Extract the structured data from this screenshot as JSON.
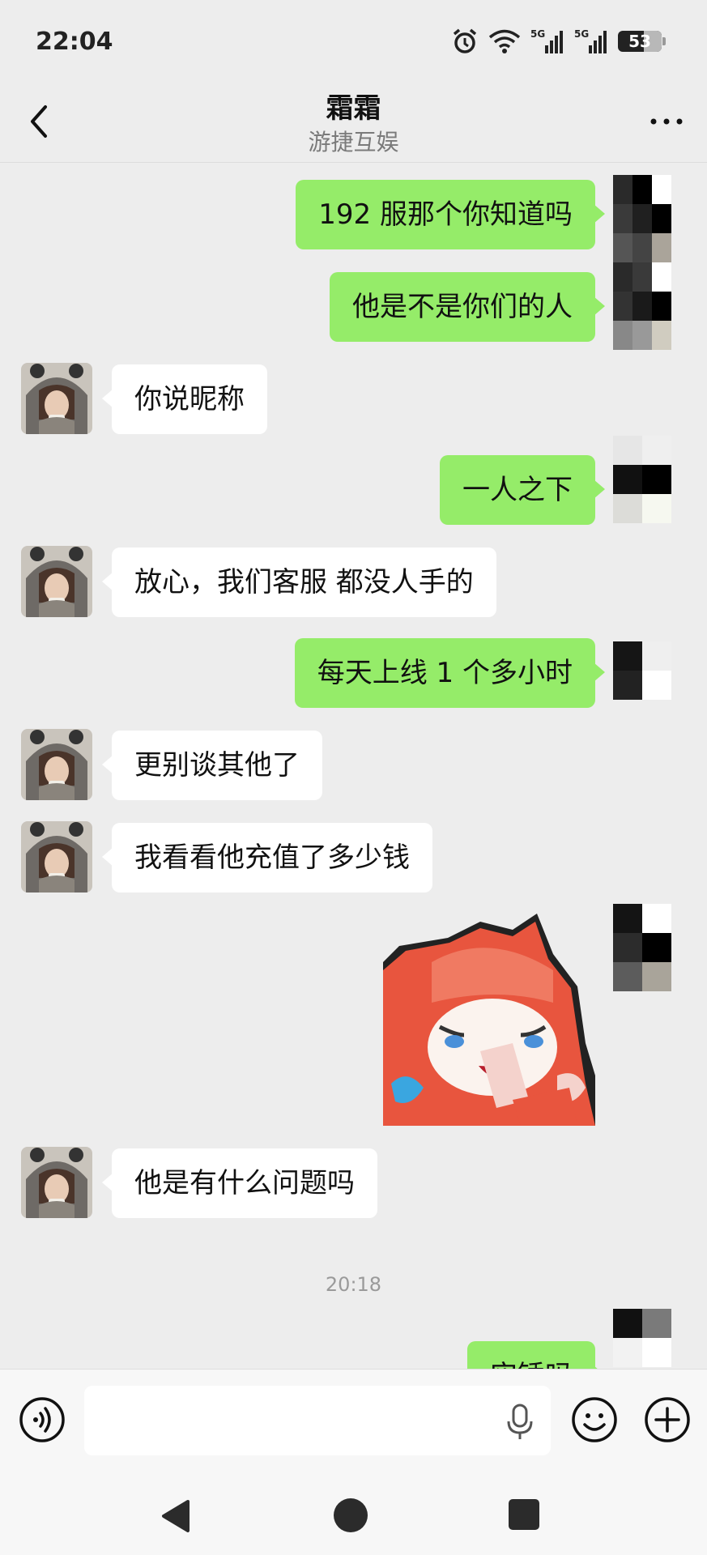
{
  "status_bar": {
    "time": "22:04",
    "battery": "53",
    "icons": [
      "alarm-icon",
      "wifi-icon",
      "signal-5g-icon",
      "signal-5g-icon"
    ]
  },
  "header": {
    "title": "霜霜",
    "subtitle": "游捷互娱",
    "back_icon": "chevron-left-icon",
    "more_icon": "more-dots-icon"
  },
  "messages": [
    {
      "from": "me",
      "text": "192 服那个你知道吗"
    },
    {
      "from": "me",
      "text": "他是不是你们的人"
    },
    {
      "from": "them",
      "text": "你说昵称"
    },
    {
      "from": "me",
      "text": "一人之下"
    },
    {
      "from": "them",
      "text": "放心，我们客服 都没人手的"
    },
    {
      "from": "me",
      "text": "每天上线 1 个多小时"
    },
    {
      "from": "them",
      "text": "更别谈其他了"
    },
    {
      "from": "them",
      "text": "我看看他充值了多少钱"
    },
    {
      "from": "me",
      "type": "sticker",
      "sticker": "laughing-red-hair-girl"
    },
    {
      "from": "them",
      "text": "他是有什么问题吗"
    },
    {
      "type": "time",
      "text": "20:18"
    },
    {
      "from": "me",
      "text": "实锤吗"
    }
  ],
  "input_bar": {
    "placeholder": "",
    "icons": [
      "voice-icon",
      "microphone-icon",
      "emoji-icon",
      "plus-icon"
    ]
  },
  "nav_bar": {
    "icons": [
      "nav-back-icon",
      "nav-home-icon",
      "nav-recents-icon"
    ]
  },
  "colors": {
    "background": "#ededed",
    "my_bubble": "#95ec69",
    "their_bubble": "#ffffff",
    "subtitle": "#7a7a7a",
    "timestamp": "#9a9a9a"
  }
}
